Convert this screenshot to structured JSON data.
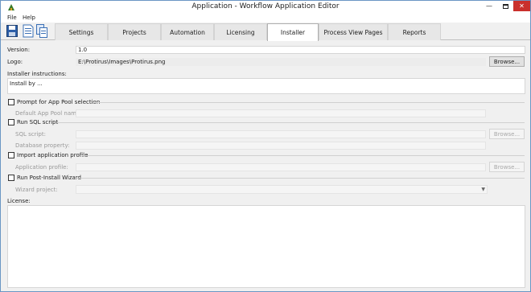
{
  "window": {
    "title": "Application - Workflow Application Editor"
  },
  "menu": {
    "file": "File",
    "help": "Help"
  },
  "tabs": [
    {
      "label": "Settings"
    },
    {
      "label": "Projects"
    },
    {
      "label": "Automation"
    },
    {
      "label": "Licensing"
    },
    {
      "label": "Installer"
    },
    {
      "label": "Process View Pages"
    },
    {
      "label": "Reports"
    }
  ],
  "active_tab": "Installer",
  "form": {
    "version_label": "Version:",
    "version_value": "1.0",
    "logo_label": "Logo:",
    "logo_value": "E:\\Protirus\\Images\\Protirus.png",
    "browse_label": "Browse...",
    "instructions_label": "Installer instructions:",
    "instructions_value": "Install by ...",
    "prompt_app_pool_label": "Prompt for App Pool selection",
    "default_app_pool_label": "Default App Pool name:",
    "run_sql_label": "Run SQL script",
    "sql_script_label": "SQL script:",
    "database_property_label": "Database property:",
    "import_profile_label": "Import application profile",
    "application_profile_label": "Application profile:",
    "run_post_install_label": "Run Post-Install Wizard",
    "wizard_project_label": "Wizard project:",
    "license_label": "License:"
  }
}
